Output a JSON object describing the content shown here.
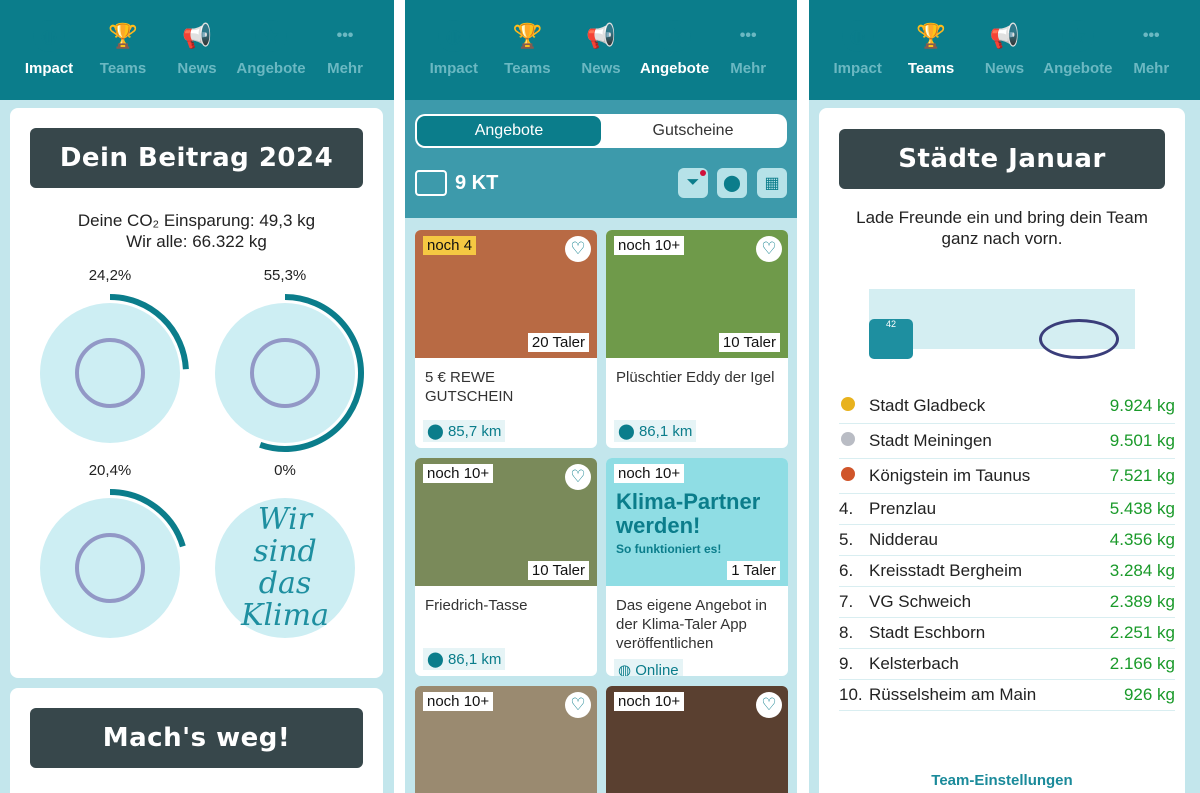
{
  "nav": [
    {
      "label": "Impact",
      "icon": "globe-icon"
    },
    {
      "label": "Teams",
      "icon": "trophy-icon"
    },
    {
      "label": "News",
      "icon": "megaphone-icon"
    },
    {
      "label": "Angebote",
      "icon": "star-icon"
    },
    {
      "label": "Mehr",
      "icon": "more-icon"
    }
  ],
  "impact": {
    "title": "Dein Beitrag 2024",
    "co2_line": "Deine CO₂ Einsparung: 49,3 kg",
    "all_line": "Wir alle: 66.322 kg",
    "categories": [
      {
        "percent": "24,2%",
        "value": 24.2,
        "icon": "running-icon"
      },
      {
        "percent": "55,3%",
        "value": 55.3,
        "icon": "bicycle-icon"
      },
      {
        "percent": "20,4%",
        "value": 20.4,
        "icon": "bus-tram-icon"
      },
      {
        "percent": "0%",
        "value": 0,
        "text": "Wir sind das Klima"
      }
    ],
    "second_title": "Mach's weg!"
  },
  "offers": {
    "tabs": [
      "Angebote",
      "Gutscheine"
    ],
    "balance": "9 KT",
    "items": [
      {
        "badge": "noch 4",
        "price": "20 Taler",
        "title": "5 € REWE GUTSCHEIN",
        "location": "85,7 km",
        "color": "#b86a44"
      },
      {
        "badge": "noch 10+",
        "price": "10 Taler",
        "title": "Plüschtier Eddy der Igel",
        "location": "86,1 km",
        "color": "#6f9a4a"
      },
      {
        "badge": "noch 10+",
        "price": "10 Taler",
        "title": "Friedrich-Tasse",
        "location": "86,1 km",
        "color": "#7a8a5a"
      },
      {
        "badge": "noch 10+",
        "price": "1 Taler",
        "title": "Das eigene Angebot in der Klima-Taler App veröffentlichen",
        "location": "Online",
        "color": "#8fdde4",
        "promo": "Klima-Partner werden!",
        "promo_sub": "So funktioniert es!"
      },
      {
        "badge": "noch 10+",
        "color": "#9a8a70"
      },
      {
        "badge": "noch 10+",
        "color": "#5a4030"
      }
    ]
  },
  "teams": {
    "title": "Städte Januar",
    "subtitle": "Lade Freunde ein und bring dein Team ganz nach vorn.",
    "bus_number": "42",
    "ranking": [
      {
        "rank": "",
        "medal": "#e8b21d",
        "name": "Stadt Gladbeck",
        "value": "9.924 kg"
      },
      {
        "rank": "",
        "medal": "#b9bcc4",
        "name": "Stadt Meiningen",
        "value": "9.501 kg"
      },
      {
        "rank": "",
        "medal": "#d0552a",
        "name": "Königstein im Taunus",
        "value": "7.521 kg"
      },
      {
        "rank": "4.",
        "name": "Prenzlau",
        "value": "5.438 kg"
      },
      {
        "rank": "5.",
        "name": "Nidderau",
        "value": "4.356 kg"
      },
      {
        "rank": "6.",
        "name": "Kreisstadt Bergheim",
        "value": "3.284 kg"
      },
      {
        "rank": "7.",
        "name": "VG Schweich",
        "value": "2.389 kg"
      },
      {
        "rank": "8.",
        "name": "Stadt Eschborn",
        "value": "2.251 kg"
      },
      {
        "rank": "9.",
        "name": "Kelsterbach",
        "value": "2.166 kg"
      },
      {
        "rank": "10.",
        "name": "Rüsselsheim am Main",
        "value": "926 kg"
      }
    ],
    "settings_link": "Team-Einstellungen"
  },
  "colors": {
    "primary": "#0b7d8b",
    "background": "#c3e6ec",
    "dark": "#37474b",
    "green": "#1a9a2a"
  }
}
